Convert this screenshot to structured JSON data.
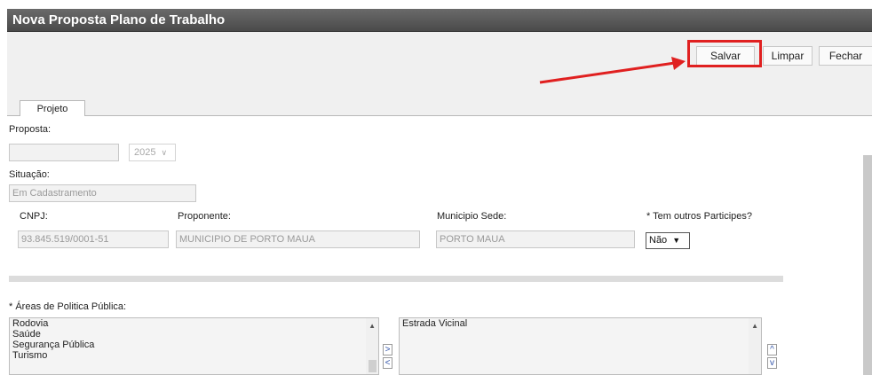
{
  "window": {
    "title": "Nova Proposta Plano de Trabalho"
  },
  "toolbar": {
    "save_label": "Salvar",
    "clear_label": "Limpar",
    "close_label": "Fechar"
  },
  "tabs": [
    {
      "label": "Projeto"
    }
  ],
  "form": {
    "proposta": {
      "label": "Proposta:",
      "value": "",
      "year": "2025"
    },
    "situacao": {
      "label": "Situação:",
      "value": "Em Cadastramento"
    },
    "cnpj": {
      "label": "CNPJ:",
      "value": "93.845.519/0001-51"
    },
    "proponente": {
      "label": "Proponente:",
      "value": "MUNICIPIO DE PORTO MAUA"
    },
    "municipio": {
      "label": "Municipio Sede:",
      "value": "PORTO MAUA"
    },
    "participes": {
      "label": "* Tem outros Participes?",
      "value": "Não"
    },
    "areas": {
      "label": "* Áreas de Politica Pública:",
      "available": [
        "Rodovia",
        "Saúde",
        "Segurança Pública",
        "Turismo"
      ],
      "selected": [
        "Estrada Vicinal"
      ],
      "add_label": ">",
      "remove_label": "<",
      "up_label": "^",
      "down_label": "v"
    }
  },
  "colors": {
    "highlight": "#e02020",
    "titlebar": "#555555"
  }
}
